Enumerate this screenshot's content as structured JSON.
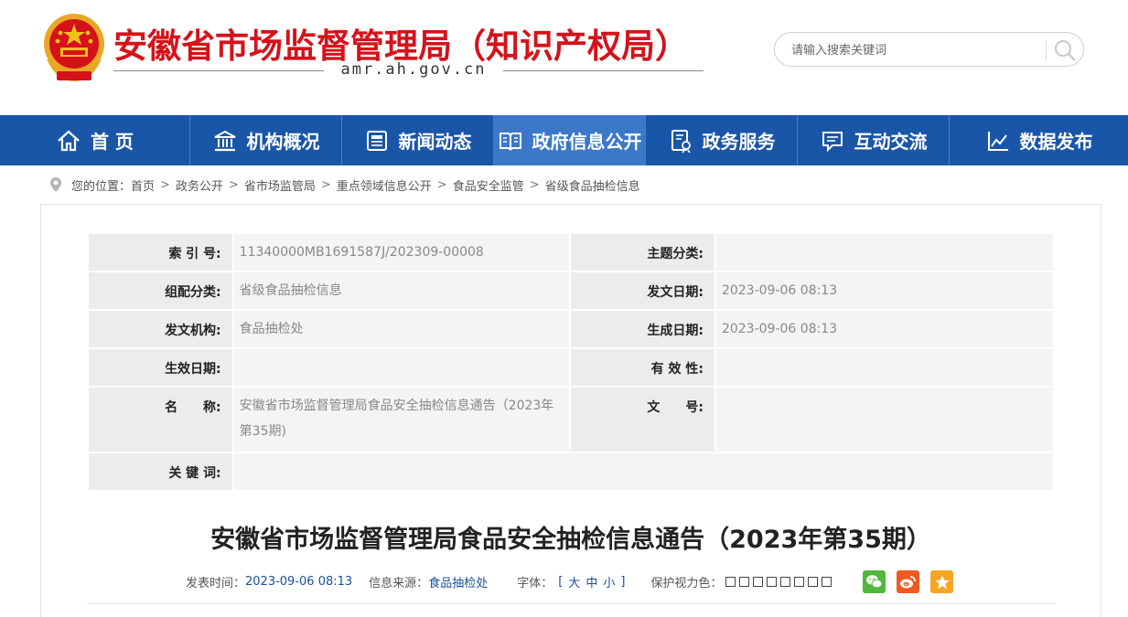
{
  "header": {
    "site_title": "安徽省市场监督管理局（知识产权局）",
    "site_domain": "amr.ah.gov.cn",
    "search_placeholder": "请输入搜索关键词",
    "colors": {
      "brand_red": "#d5121a",
      "nav_blue": "#1a56a8",
      "nav_active": "#3c78c8"
    }
  },
  "nav": {
    "items": [
      {
        "label": "首 页",
        "icon": "home-icon"
      },
      {
        "label": "机构概况",
        "icon": "building-icon"
      },
      {
        "label": "新闻动态",
        "icon": "newspaper-icon"
      },
      {
        "label": "政府信息公开",
        "icon": "open-book-icon",
        "active": true
      },
      {
        "label": "政务服务",
        "icon": "service-doc-icon"
      },
      {
        "label": "互动交流",
        "icon": "chat-icon"
      },
      {
        "label": "数据发布",
        "icon": "line-chart-icon"
      }
    ]
  },
  "breadcrumb": {
    "prefix": "您的位置：",
    "items": [
      "首页",
      "政务公开",
      "省市场监管局",
      "重点领域信息公开",
      "食品安全监管",
      "省级食品抽检信息"
    ],
    "separator": ">"
  },
  "info": {
    "index_label": "索 引 号:",
    "index_value": "11340000MB1691587J/202309-00008",
    "topic_label": "主题分类:",
    "topic_value": "",
    "group_label": "组配分类:",
    "group_value": "省级食品抽检信息",
    "issue_date_label": "发文日期:",
    "issue_date_value": "2023-09-06 08:13",
    "org_label": "发文机构:",
    "org_value": "食品抽检处",
    "gen_date_label": "生成日期:",
    "gen_date_value": "2023-09-06 08:13",
    "effective_label": "生效日期:",
    "effective_value": "",
    "validity_label": "有 效 性:",
    "validity_value": "",
    "name_label": "名　　称:",
    "name_value": "安徽省市场监督管理局食品安全抽检信息通告（2023年第35期)",
    "docno_label": "文　　号:",
    "docno_value": "",
    "keywords_label": "关 键 词:",
    "keywords_value": ""
  },
  "article": {
    "title": "安徽省市场监督管理局食品安全抽检信息通告（2023年第35期）",
    "publish_label": "发表时间：",
    "publish_time": "2023-09-06 08:13",
    "source_label": "信息来源：",
    "source": "食品抽检处",
    "font_label": "字体：",
    "font_open": "[",
    "font_large": "大",
    "font_medium": "中",
    "font_small": "小",
    "font_close": "]",
    "eye_label": "保护视力色：",
    "eye_colors": [
      "#ffffff",
      "#ffffff",
      "#ffffff",
      "#ffffff",
      "#ffffff",
      "#ffffff",
      "#ffffff",
      "#ffffff"
    ],
    "share": [
      {
        "name": "wechat",
        "color": "#4fb83a"
      },
      {
        "name": "weibo",
        "color": "#ef5a20"
      },
      {
        "name": "qzone",
        "color": "#f5a623"
      }
    ]
  }
}
